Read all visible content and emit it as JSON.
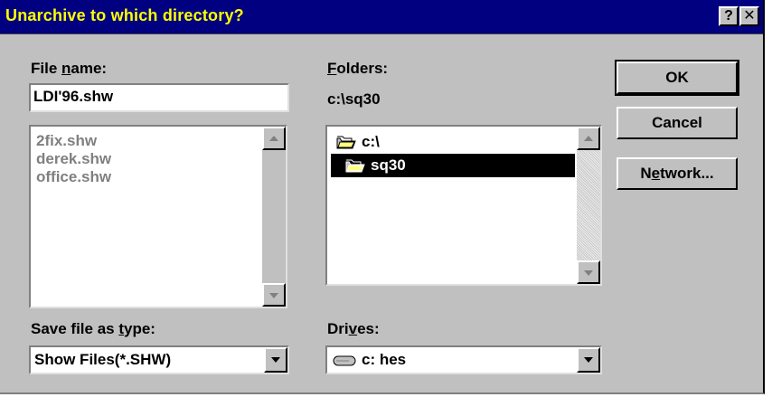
{
  "window": {
    "title": "Unarchive to which directory?"
  },
  "titlebar_buttons": {
    "help": "?",
    "close": "✕"
  },
  "file_name": {
    "label_pre": "File ",
    "label_key": "n",
    "label_post": "ame:",
    "value": "LDI'96.shw",
    "files": [
      "2fix.shw",
      "derek.shw",
      "office.shw"
    ]
  },
  "folders": {
    "label_key": "F",
    "label_post": "olders:",
    "current_path": "c:\\sq30",
    "items": [
      {
        "name": "c:\\",
        "icon": "open-folder-icon"
      },
      {
        "name": "sq30",
        "icon": "open-folder-icon",
        "selected": true
      }
    ]
  },
  "save_type": {
    "label_pre": "Save file as ",
    "label_key": "t",
    "label_post": "ype:",
    "value": "Show Files(*.SHW)"
  },
  "drives": {
    "label_pre": "Dri",
    "label_key": "v",
    "label_post": "es:",
    "value": "c: hes",
    "icon": "hard-drive-icon"
  },
  "buttons": {
    "ok": "OK",
    "cancel": "Cancel",
    "network_pre": "N",
    "network_key": "e",
    "network_post": "twork..."
  },
  "colors": {
    "title_bar": "#000080",
    "title_text": "#ffff00",
    "face": "#c0c0c0",
    "disabled_text": "#808080"
  }
}
